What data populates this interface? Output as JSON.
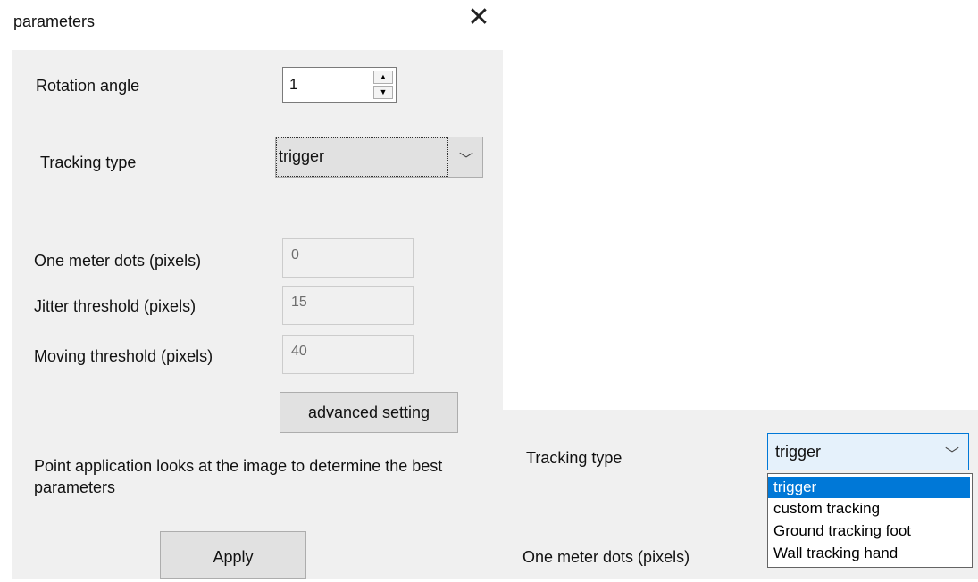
{
  "dialog": {
    "title": "parameters",
    "close_glyph": "✕",
    "rotation_label": "Rotation angle",
    "rotation_value": "1",
    "spin_up_glyph": "▲",
    "spin_down_glyph": "▼",
    "tracking_label": "Tracking type",
    "tracking_value": "trigger",
    "chevron_glyph": "﹀",
    "one_meter_label": "One meter dots (pixels)",
    "one_meter_value": "0",
    "jitter_label": "Jitter threshold (pixels)",
    "jitter_value": "15",
    "moving_label": "Moving threshold (pixels)",
    "moving_value": "40",
    "advanced_button": "advanced setting",
    "hint": "Point application looks at the image to determine the best parameters",
    "apply_button": "Apply"
  },
  "dropdown_view": {
    "tracking_label": "Tracking type",
    "selected_value": "trigger",
    "one_meter_label": "One meter dots (pixels)",
    "options": [
      "trigger",
      "custom tracking",
      "Ground tracking foot",
      "Wall tracking hand"
    ],
    "selected_index": 0
  },
  "colors": {
    "panel_bg": "#f0f0f0",
    "selection": "#0078d7",
    "combo_focus_bg": "#e5f1fb"
  }
}
